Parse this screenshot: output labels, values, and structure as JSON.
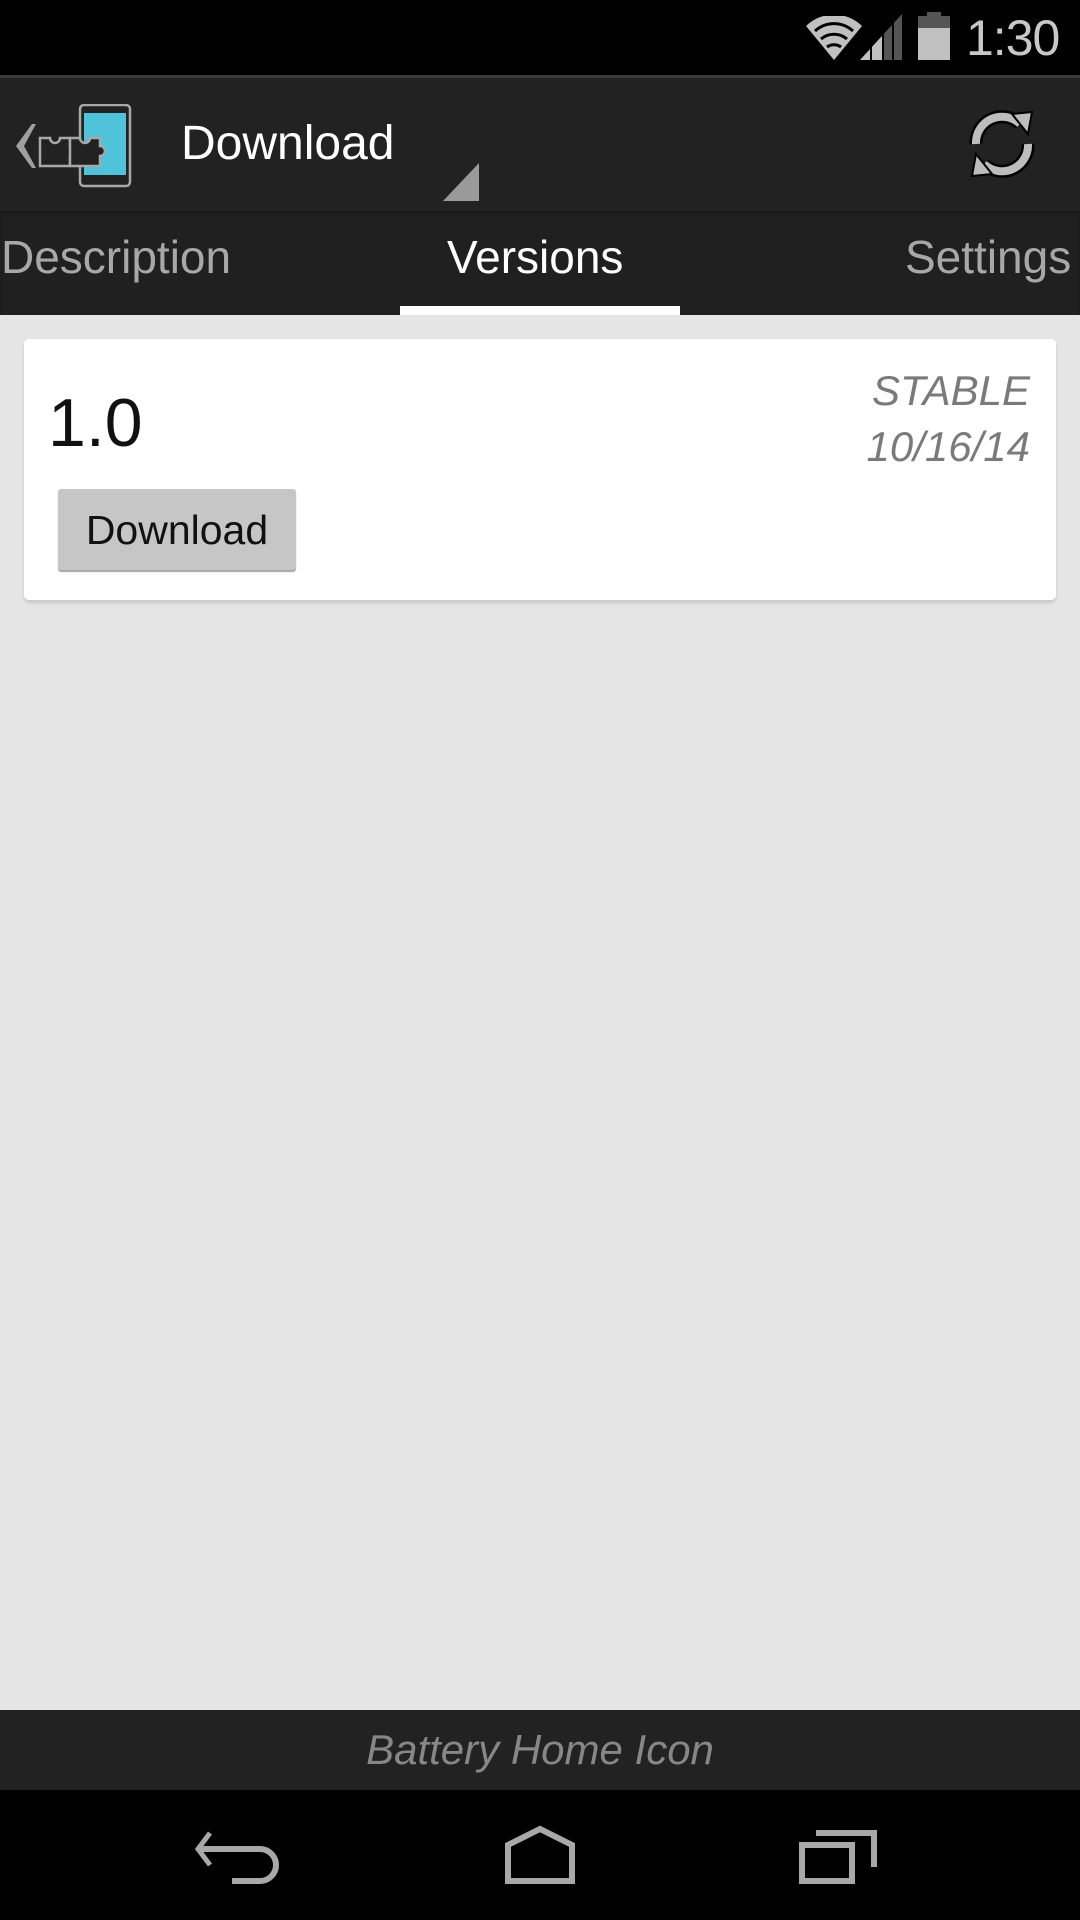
{
  "status_bar": {
    "time": "1:30",
    "icons": [
      "wifi-icon",
      "cell-signal-icon",
      "battery-icon"
    ]
  },
  "action_bar": {
    "title": "Download",
    "app_icon": "xposed-puzzle-phone-icon",
    "actions": [
      "refresh-icon"
    ]
  },
  "tabs": [
    {
      "label": "Description",
      "active": false
    },
    {
      "label": "Versions",
      "active": true
    },
    {
      "label": "Settings",
      "active": false
    }
  ],
  "versions": [
    {
      "number": "1.0",
      "branch": "STABLE",
      "date": "10/16/14",
      "button_label": "Download"
    }
  ],
  "footer": {
    "module_name": "Battery Home Icon"
  },
  "nav_bar": {
    "buttons": [
      "back-icon",
      "home-icon",
      "recents-icon"
    ]
  },
  "colors": {
    "accent_tab_indicator": "#ffffff",
    "app_icon_screen": "#4fc3d9",
    "action_bar_bg": "#222222",
    "content_bg": "#e5e5e5"
  }
}
